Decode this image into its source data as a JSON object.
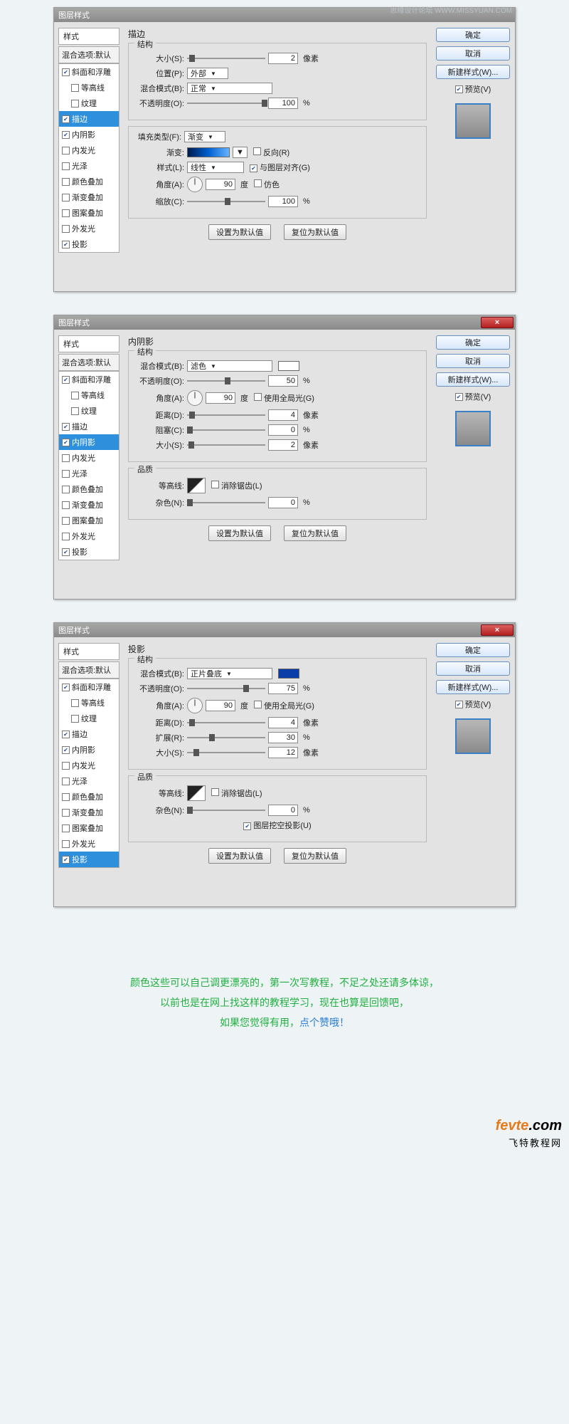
{
  "watermark": "思缘设计论坛   WWW.MISSYUAN.COM",
  "dialogs": [
    {
      "title": "图层样式",
      "showClose": false,
      "left": {
        "head": "样式",
        "blend": "混合选项:默认",
        "items": [
          {
            "label": "斜面和浮雕",
            "checked": true,
            "sel": false
          },
          {
            "label": "等高线",
            "checked": false,
            "sel": false,
            "indent": true
          },
          {
            "label": "纹理",
            "checked": false,
            "sel": false,
            "indent": true
          },
          {
            "label": "描边",
            "checked": true,
            "sel": true
          },
          {
            "label": "内阴影",
            "checked": true,
            "sel": false
          },
          {
            "label": "内发光",
            "checked": false,
            "sel": false
          },
          {
            "label": "光泽",
            "checked": false,
            "sel": false
          },
          {
            "label": "颜色叠加",
            "checked": false,
            "sel": false
          },
          {
            "label": "渐变叠加",
            "checked": false,
            "sel": false
          },
          {
            "label": "图案叠加",
            "checked": false,
            "sel": false
          },
          {
            "label": "外发光",
            "checked": false,
            "sel": false
          },
          {
            "label": "投影",
            "checked": true,
            "sel": false
          }
        ]
      },
      "panel": "stroke",
      "stroke": {
        "title": "描边",
        "fs1": "结构",
        "size_l": "大小(S):",
        "size_v": "2",
        "size_u": "像素",
        "pos_l": "位置(P):",
        "pos_v": "外部",
        "blend_l": "混合模式(B):",
        "blend_v": "正常",
        "op_l": "不透明度(O):",
        "op_v": "100",
        "op_u": "%",
        "fill_l": "填充类型(F):",
        "fill_v": "渐变",
        "grad_l": "渐变:",
        "rev_l": "反向(R)",
        "style_l": "样式(L):",
        "style_v": "线性",
        "align_l": "与图层对齐(G)",
        "ang_l": "角度(A):",
        "ang_v": "90",
        "ang_u": "度",
        "dith_l": "仿色",
        "scale_l": "缩放(C):",
        "scale_v": "100",
        "scale_u": "%",
        "btn1": "设置为默认值",
        "btn2": "复位为默认值"
      },
      "right": {
        "ok": "确定",
        "cancel": "取消",
        "new": "新建样式(W)...",
        "prev": "预览(V)"
      }
    },
    {
      "title": "图层样式",
      "showClose": true,
      "left": {
        "head": "样式",
        "blend": "混合选项:默认",
        "items": [
          {
            "label": "斜面和浮雕",
            "checked": true,
            "sel": false
          },
          {
            "label": "等高线",
            "checked": false,
            "sel": false,
            "indent": true
          },
          {
            "label": "纹理",
            "checked": false,
            "sel": false,
            "indent": true
          },
          {
            "label": "描边",
            "checked": true,
            "sel": false
          },
          {
            "label": "内阴影",
            "checked": true,
            "sel": true
          },
          {
            "label": "内发光",
            "checked": false,
            "sel": false
          },
          {
            "label": "光泽",
            "checked": false,
            "sel": false
          },
          {
            "label": "颜色叠加",
            "checked": false,
            "sel": false
          },
          {
            "label": "渐变叠加",
            "checked": false,
            "sel": false
          },
          {
            "label": "图案叠加",
            "checked": false,
            "sel": false
          },
          {
            "label": "外发光",
            "checked": false,
            "sel": false
          },
          {
            "label": "投影",
            "checked": true,
            "sel": false
          }
        ]
      },
      "panel": "inner",
      "inner": {
        "title": "内阴影",
        "fs1": "结构",
        "blend_l": "混合模式(B):",
        "blend_v": "滤色",
        "op_l": "不透明度(O):",
        "op_v": "50",
        "op_u": "%",
        "ang_l": "角度(A):",
        "ang_v": "90",
        "ang_u": "度",
        "glob_l": "使用全局光(G)",
        "dist_l": "距离(D):",
        "dist_v": "4",
        "dist_u": "像素",
        "choke_l": "阻塞(C):",
        "choke_v": "0",
        "choke_u": "%",
        "size_l": "大小(S):",
        "size_v": "2",
        "size_u": "像素",
        "fs2": "品质",
        "cont_l": "等高线:",
        "aa_l": "消除锯齿(L)",
        "noise_l": "杂色(N):",
        "noise_v": "0",
        "noise_u": "%",
        "btn1": "设置为默认值",
        "btn2": "复位为默认值"
      },
      "right": {
        "ok": "确定",
        "cancel": "取消",
        "new": "新建样式(W)...",
        "prev": "预览(V)"
      }
    },
    {
      "title": "图层样式",
      "showClose": true,
      "left": {
        "head": "样式",
        "blend": "混合选项:默认",
        "items": [
          {
            "label": "斜面和浮雕",
            "checked": true,
            "sel": false
          },
          {
            "label": "等高线",
            "checked": false,
            "sel": false,
            "indent": true
          },
          {
            "label": "纹理",
            "checked": false,
            "sel": false,
            "indent": true
          },
          {
            "label": "描边",
            "checked": true,
            "sel": false
          },
          {
            "label": "内阴影",
            "checked": true,
            "sel": false
          },
          {
            "label": "内发光",
            "checked": false,
            "sel": false
          },
          {
            "label": "光泽",
            "checked": false,
            "sel": false
          },
          {
            "label": "颜色叠加",
            "checked": false,
            "sel": false
          },
          {
            "label": "渐变叠加",
            "checked": false,
            "sel": false
          },
          {
            "label": "图案叠加",
            "checked": false,
            "sel": false
          },
          {
            "label": "外发光",
            "checked": false,
            "sel": false
          },
          {
            "label": "投影",
            "checked": true,
            "sel": true
          }
        ]
      },
      "panel": "drop",
      "drop": {
        "title": "投影",
        "fs1": "结构",
        "blend_l": "混合模式(B):",
        "blend_v": "正片叠底",
        "op_l": "不透明度(O):",
        "op_v": "75",
        "op_u": "%",
        "ang_l": "角度(A):",
        "ang_v": "90",
        "ang_u": "度",
        "glob_l": "使用全局光(G)",
        "dist_l": "距离(D):",
        "dist_v": "4",
        "dist_u": "像素",
        "spread_l": "扩展(R):",
        "spread_v": "30",
        "spread_u": "%",
        "size_l": "大小(S):",
        "size_v": "12",
        "size_u": "像素",
        "fs2": "品质",
        "cont_l": "等高线:",
        "aa_l": "消除锯齿(L)",
        "noise_l": "杂色(N):",
        "noise_v": "0",
        "noise_u": "%",
        "knock_l": "图层挖空投影(U)",
        "btn1": "设置为默认值",
        "btn2": "复位为默认值"
      },
      "right": {
        "ok": "确定",
        "cancel": "取消",
        "new": "新建样式(W)...",
        "prev": "预览(V)"
      }
    }
  ],
  "footer": {
    "l1": "颜色这些可以自己调更漂亮的，第一次写教程，不足之处还请多体谅，",
    "l2": "以前也是在网上找这样的教程学习，现在也算是回馈吧，",
    "l3a": "如果您觉得有用，",
    "l3b": "点个赞哦！"
  },
  "brand": {
    "a": "fevte",
    "b": ".com",
    "c": "飞特教程网"
  }
}
